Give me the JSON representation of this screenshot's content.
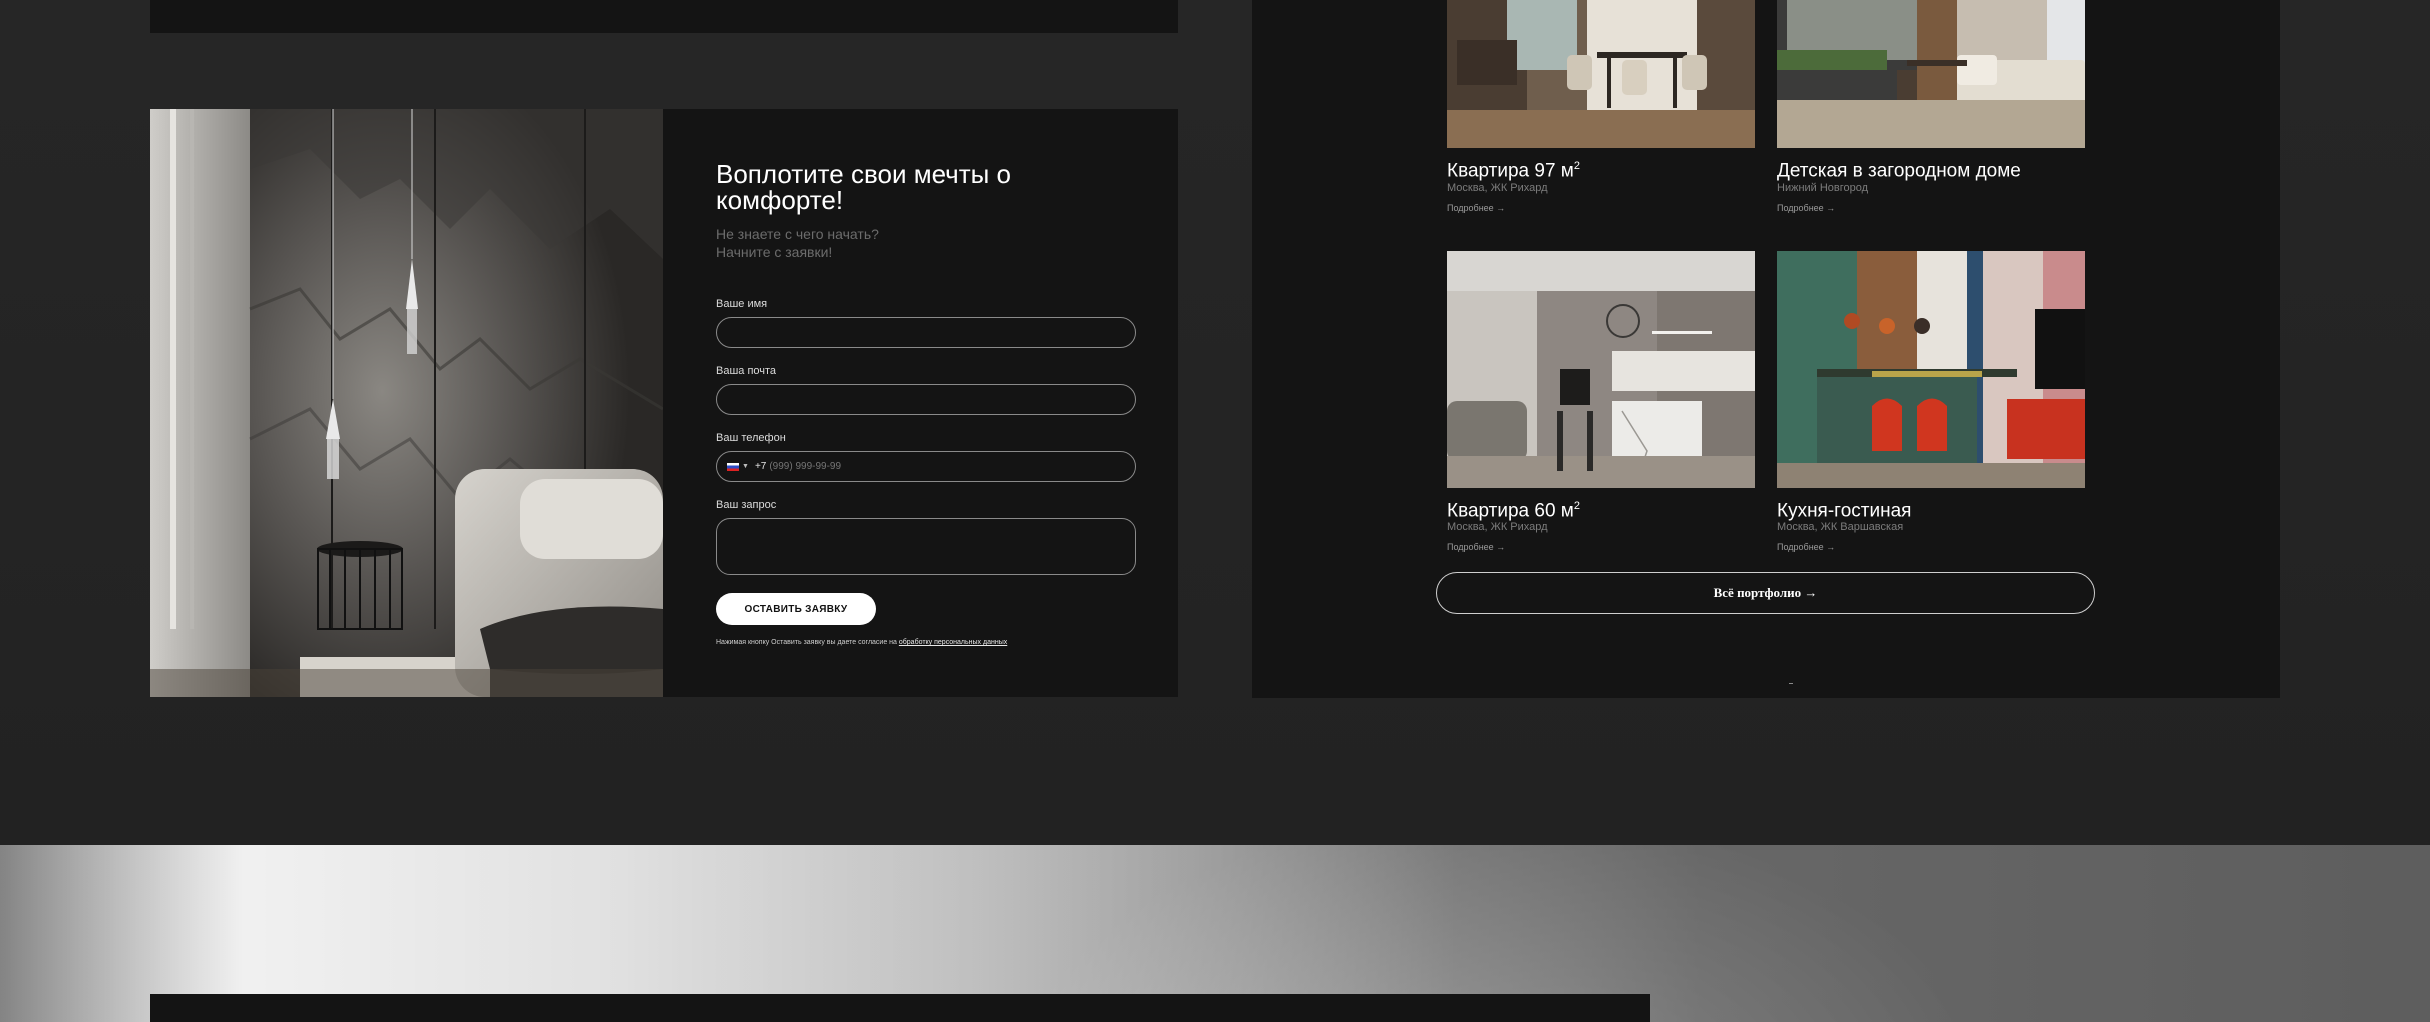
{
  "form": {
    "title": "Воплотите свои мечты о комфорте!",
    "subtitle_line1": "Не знаете с чего начать?",
    "subtitle_line2": "Начните с заявки!",
    "name_label": "Ваше имя",
    "email_label": "Ваша почта",
    "phone_label": "Ваш телефон",
    "phone_prefix": "+7",
    "phone_placeholder": "(999) 999-99-99",
    "request_label": "Ваш запрос",
    "submit_label": "ОСТАВИТЬ ЗАЯВКУ",
    "consent_text": "Нажимая кнопку Оставить заявку вы даете согласие на",
    "consent_link": "обработку персональных данных"
  },
  "portfolio": {
    "items": [
      {
        "title": "Квартира 97 м",
        "sup": "2",
        "location": "Москва, ЖК Рихард",
        "more": "Подробнее →"
      },
      {
        "title": "Детская в загородном доме",
        "sup": "",
        "location": "Нижний Новгород",
        "more": "Подробнее →"
      },
      {
        "title": "Квартира 60 м",
        "sup": "2",
        "location": "Москва, ЖК Рихард",
        "more": "Подробнее →"
      },
      {
        "title": "Кухня-гостиная",
        "sup": "",
        "location": "Москва, ЖК Варшавская",
        "more": "Подробнее →"
      }
    ],
    "all_label": "Всё портфолио →"
  },
  "colors": {
    "page_bg": "#262626",
    "card_bg": "#141414",
    "accent_red": "#c8321f"
  }
}
